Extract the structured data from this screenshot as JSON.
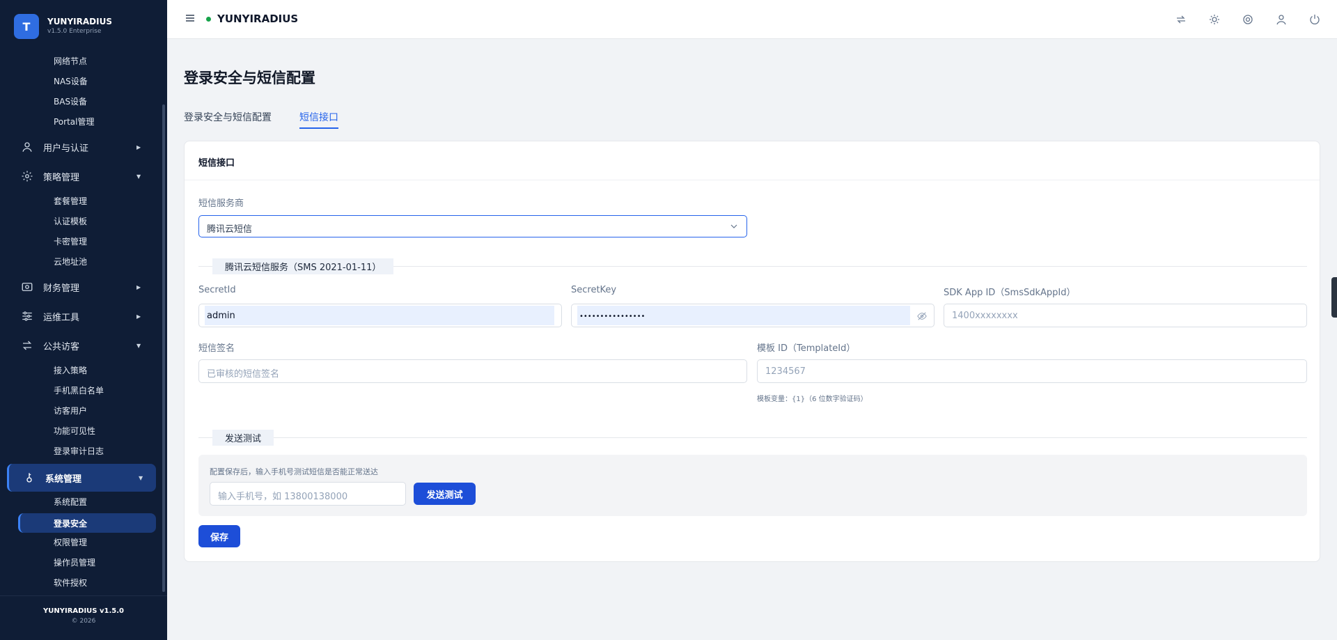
{
  "brand": {
    "logo_letter": "T",
    "name": "YUNYIRADIUS",
    "version": "v1.5.0 Enterprise"
  },
  "sidebar": {
    "top_items": [
      "网络节点",
      "NAS设备",
      "BAS设备",
      "Portal管理"
    ],
    "group_users": "用户与认证",
    "group_policy": "策略管理",
    "policy_items": [
      "套餐管理",
      "认证模板",
      "卡密管理",
      "云地址池"
    ],
    "group_finance": "财务管理",
    "group_ops": "运维工具",
    "group_guest": "公共访客",
    "guest_items": [
      "接入策略",
      "手机黑白名单",
      "访客用户",
      "功能可见性",
      "登录审计日志"
    ],
    "group_system": "系统管理",
    "system_items": [
      "系统配置",
      "登录安全",
      "权限管理",
      "操作员管理",
      "软件授权"
    ],
    "footer_name": "YUNYIRADIUS v1.5.0",
    "footer_copy": "© 2026"
  },
  "header": {
    "title": "YUNYIRADIUS"
  },
  "main": {
    "page_title": "登录安全与短信配置",
    "tabs": [
      {
        "label": "登录安全与短信配置",
        "active": false
      },
      {
        "label": "短信接口",
        "active": true
      }
    ],
    "card_title": "短信接口",
    "provider_label": "短信服务商",
    "provider_value": "腾讯云短信",
    "section_tencent": "腾讯云短信服务（SMS 2021-01-11）",
    "secret_id_label": "SecretId",
    "secret_id_value": "admin",
    "secret_key_label": "SecretKey",
    "secret_key_value": "••••••••••••••••",
    "sdk_app_label": "SDK App ID（SmsSdkAppId）",
    "sdk_app_placeholder": "1400xxxxxxxx",
    "sign_label": "短信签名",
    "sign_placeholder": "已审核的短信签名",
    "template_label": "模板 ID（TemplateId）",
    "template_placeholder": "1234567",
    "template_hint": "模板变量：{1}（6 位数字验证码）",
    "section_test": "发送测试",
    "test_desc": "配置保存后，输入手机号测试短信是否能正常送达",
    "phone_placeholder": "输入手机号，如 13800138000",
    "send_test_button": "发送测试",
    "save_button": "保存"
  },
  "colors": {
    "sidebar_bg": "#0f1d36",
    "accent": "#2563eb",
    "button": "#1d4ed8",
    "status_online": "#16a34a"
  }
}
